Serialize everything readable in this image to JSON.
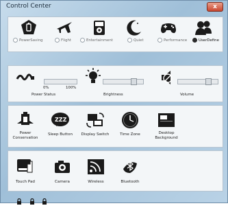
{
  "window": {
    "title": "Control Center",
    "close_glyph": "x"
  },
  "modes": [
    {
      "label": "PowerSaving",
      "selected": false,
      "icon": "power-saving-icon"
    },
    {
      "label": "Flight",
      "selected": false,
      "icon": "airplane-icon"
    },
    {
      "label": "Entertainment",
      "selected": false,
      "icon": "entertainment-icon"
    },
    {
      "label": "Quiet",
      "selected": false,
      "icon": "moon-icon"
    },
    {
      "label": "Performance",
      "selected": false,
      "icon": "gamepad-icon"
    },
    {
      "label": "UserDefine",
      "selected": true,
      "icon": "users-icon"
    }
  ],
  "power_status": {
    "label": "Power Status",
    "min_label": "0%",
    "max_label": "100%",
    "level_percent": 0
  },
  "brightness": {
    "label": "Brightness",
    "level_fraction": 0.75
  },
  "volume": {
    "label": "Volume",
    "level_fraction": 0.75
  },
  "tools": [
    {
      "label_line1": "Power",
      "label_line2": "Conservation",
      "icon": "power-conservation-icon"
    },
    {
      "label_line1": "Sleep Button",
      "label_line2": "",
      "icon": "sleep-zzz-icon"
    },
    {
      "label_line1": "Display Switch",
      "label_line2": "",
      "icon": "display-switch-icon"
    },
    {
      "label_line1": "Time Zone",
      "label_line2": "",
      "icon": "clock-icon"
    },
    {
      "label_line1": "Desktop",
      "label_line2": "Background",
      "icon": "desktop-background-icon"
    }
  ],
  "devices": [
    {
      "label": "Touch Pad",
      "icon": "touchpad-icon"
    },
    {
      "label": "Camera",
      "icon": "camera-icon"
    },
    {
      "label": "Wireless",
      "icon": "wireless-icon"
    },
    {
      "label": "Bluetooth",
      "icon": "bluetooth-icon"
    }
  ],
  "locks": [
    "lock-icon",
    "lock-icon",
    "lock-icon"
  ]
}
